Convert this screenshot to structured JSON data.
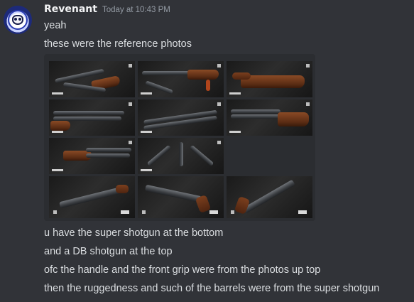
{
  "message": {
    "author": "Revenant",
    "timestamp": "Today at 10:43 PM",
    "lines_before": [
      "yeah",
      "these were the reference photos"
    ],
    "lines_after": [
      "u have the super shotgun at the bottom",
      "and a DB shotgun at the top",
      "ofc the handle and the front grip were from the photos up top",
      "then the ruggedness and such of the barrels were from the super shotgun"
    ]
  },
  "attachment": {
    "image_count": 11,
    "rows": [
      {
        "count": 3,
        "content": "double-barrel shotgun reference photos"
      },
      {
        "count": 3,
        "content": "double-barrel shotgun reference photos"
      },
      {
        "count": 2,
        "content": "double-barrel shotgun reference photos"
      },
      {
        "count": 3,
        "content": "super shotgun renders"
      }
    ]
  },
  "colors": {
    "background": "#313338",
    "username": "#f2f3f5",
    "text": "#dbdee1",
    "timestamp": "#949ba4",
    "gallery_bg": "#2b2d31"
  },
  "icons": {
    "avatar": "avatar-icon"
  }
}
